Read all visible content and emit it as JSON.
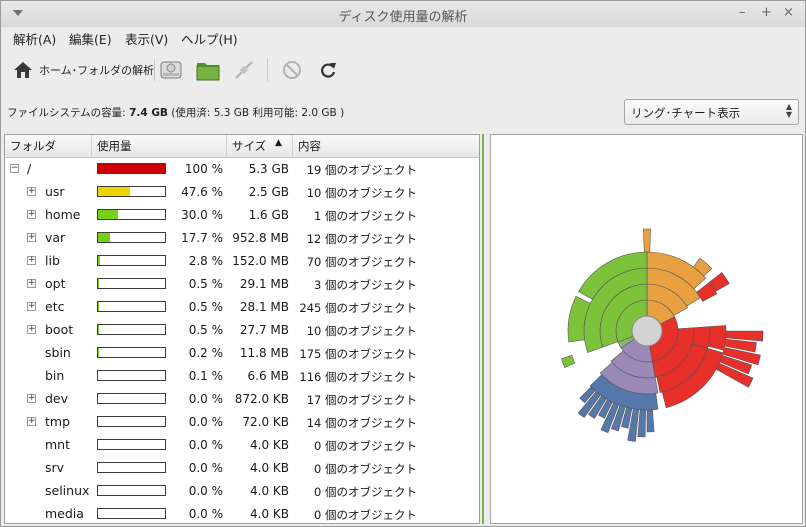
{
  "window": {
    "title": "ディスク使用量の解析"
  },
  "menu": {
    "items": [
      "解析(A)",
      "編集(E)",
      "表示(V)",
      "ヘルプ(H)"
    ]
  },
  "toolbar": {
    "home_label": "ホーム･フォルダの解析",
    "icons": [
      "home-icon",
      "disk-icon",
      "folder-icon",
      "remote-plug-icon",
      "stop-icon",
      "refresh-icon"
    ]
  },
  "infobar": {
    "prefix": "ファイルシステムの容量: ",
    "capacity": "7.4 GB",
    "details": " (使用済: 5.3 GB 利用可能: 2.0 GB )"
  },
  "view_select": {
    "value": "リング･チャート表示"
  },
  "tree": {
    "columns": [
      "フォルダ",
      "使用量",
      "サイズ",
      "内容"
    ],
    "rows": [
      {
        "expander": "minus",
        "name": "/",
        "fill": 1.0,
        "color": "#cc0000",
        "pct": "100 %",
        "size": "5.3 GB",
        "contents": "19 個のオブジェクト"
      },
      {
        "expander": "plus",
        "name": "usr",
        "fill": 0.476,
        "color": "#edd400",
        "pct": "47.6 %",
        "size": "2.5 GB",
        "contents": "10 個のオブジェクト"
      },
      {
        "expander": "plus",
        "name": "home",
        "fill": 0.3,
        "color": "#73d216",
        "pct": "30.0 %",
        "size": "1.6 GB",
        "contents": "1 個のオブジェクト"
      },
      {
        "expander": "plus",
        "name": "var",
        "fill": 0.177,
        "color": "#73d216",
        "pct": "17.7 %",
        "size": "952.8 MB",
        "contents": "12 個のオブジェクト"
      },
      {
        "expander": "plus",
        "name": "lib",
        "fill": 0.028,
        "color": "#73d216",
        "pct": "2.8 %",
        "size": "152.0 MB",
        "contents": "70 個のオブジェクト"
      },
      {
        "expander": "plus",
        "name": "opt",
        "fill": 0.005,
        "color": "#73d216",
        "pct": "0.5 %",
        "size": "29.1 MB",
        "contents": "3 個のオブジェクト"
      },
      {
        "expander": "plus",
        "name": "etc",
        "fill": 0.005,
        "color": "#73d216",
        "pct": "0.5 %",
        "size": "28.1 MB",
        "contents": "245 個のオブジェクト"
      },
      {
        "expander": "plus",
        "name": "boot",
        "fill": 0.005,
        "color": "#73d216",
        "pct": "0.5 %",
        "size": "27.7 MB",
        "contents": "10 個のオブジェクト"
      },
      {
        "expander": "none",
        "name": "sbin",
        "fill": 0.002,
        "color": "#73d216",
        "pct": "0.2 %",
        "size": "11.8 MB",
        "contents": "175 個のオブジェクト"
      },
      {
        "expander": "none",
        "name": "bin",
        "fill": 0.001,
        "color": "#73d216",
        "pct": "0.1 %",
        "size": "6.6 MB",
        "contents": "116 個のオブジェクト"
      },
      {
        "expander": "plus",
        "name": "dev",
        "fill": 0.0,
        "color": "#73d216",
        "pct": "0.0 %",
        "size": "872.0 KB",
        "contents": "17 個のオブジェクト"
      },
      {
        "expander": "plus",
        "name": "tmp",
        "fill": 0.0,
        "color": "#73d216",
        "pct": "0.0 %",
        "size": "72.0 KB",
        "contents": "14 個のオブジェクト"
      },
      {
        "expander": "none",
        "name": "mnt",
        "fill": 0.0,
        "color": "#73d216",
        "pct": "0.0 %",
        "size": "4.0 KB",
        "contents": "0 個のオブジェクト"
      },
      {
        "expander": "none",
        "name": "srv",
        "fill": 0.0,
        "color": "#73d216",
        "pct": "0.0 %",
        "size": "4.0 KB",
        "contents": "0 個のオブジェクト"
      },
      {
        "expander": "none",
        "name": "selinux",
        "fill": 0.0,
        "color": "#73d216",
        "pct": "0.0 %",
        "size": "4.0 KB",
        "contents": "0 個のオブジェクト"
      },
      {
        "expander": "none",
        "name": "media",
        "fill": 0.0,
        "color": "#73d216",
        "pct": "0.0 %",
        "size": "4.0 KB",
        "contents": "0 個のオブジェクト"
      }
    ]
  },
  "ring_colors": {
    "center": "#d3d3d3",
    "home": "#7cc23a",
    "usr_orange": "#e8a040",
    "var_red": "#e8302a",
    "lib_purple": "#9b8ab8",
    "blue": "#5577aa"
  }
}
